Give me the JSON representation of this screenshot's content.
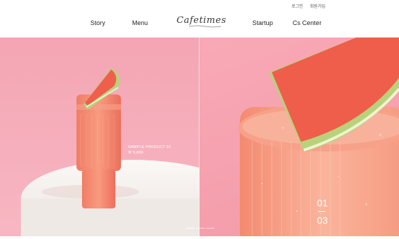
{
  "utility": {
    "login": "로그인",
    "join": "회원가입"
  },
  "nav": {
    "story": "Story",
    "menu": "Menu",
    "logo": "Cafetimes",
    "startup": "Startup",
    "cs_center": "Cs Center"
  },
  "slide": {
    "title": "SAMPLE PRODUCT 01",
    "price": "￦ 5,000"
  },
  "slider": {
    "current": "01",
    "total": "03",
    "active_index": 1,
    "count": 3
  },
  "colors": {
    "pink_bg": "#f4a5b3",
    "drink": "#f47a63",
    "rind": "#b8d07a",
    "pedestal": "#f5f2ef"
  }
}
